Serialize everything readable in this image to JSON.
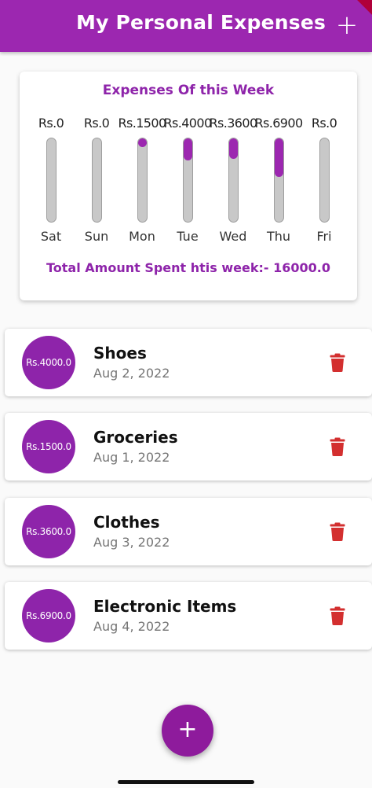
{
  "app_bar": {
    "title": "My Personal Expenses",
    "add_icon": "plus-icon",
    "add_label": "+",
    "color": "#9c27b0"
  },
  "chart": {
    "title": "Expenses Of this Week",
    "total_text": "Total Amount Spent htis week:- 16000.0"
  },
  "chart_data": {
    "type": "bar",
    "title": "Expenses Of this Week",
    "categories": [
      "Sat",
      "Sun",
      "Mon",
      "Tue",
      "Wed",
      "Thu",
      "Fri"
    ],
    "value_labels": [
      "Rs.0",
      "Rs.0",
      "Rs.1500",
      "Rs.4000",
      "Rs.3600",
      "Rs.6900",
      "Rs.0"
    ],
    "values": [
      0,
      0,
      1500,
      4000,
      3600,
      6900,
      0
    ],
    "total": 16000,
    "max": 16000,
    "fill_color": "#9c27b0",
    "track_color": "#c8c8c8"
  },
  "transactions": [
    {
      "amount": "Rs.4000.0",
      "title": "Shoes",
      "date": "Aug 2, 2022"
    },
    {
      "amount": "Rs.1500.0",
      "title": "Groceries",
      "date": "Aug 1, 2022"
    },
    {
      "amount": "Rs.3600.0",
      "title": "Clothes",
      "date": "Aug 3, 2022"
    },
    {
      "amount": "Rs.6900.0",
      "title": "Electronic Items",
      "date": "Aug 4, 2022"
    }
  ],
  "delete_icon": "trash-icon",
  "delete_color": "#d32f2f",
  "fab": {
    "label": "+",
    "icon": "plus-icon"
  }
}
